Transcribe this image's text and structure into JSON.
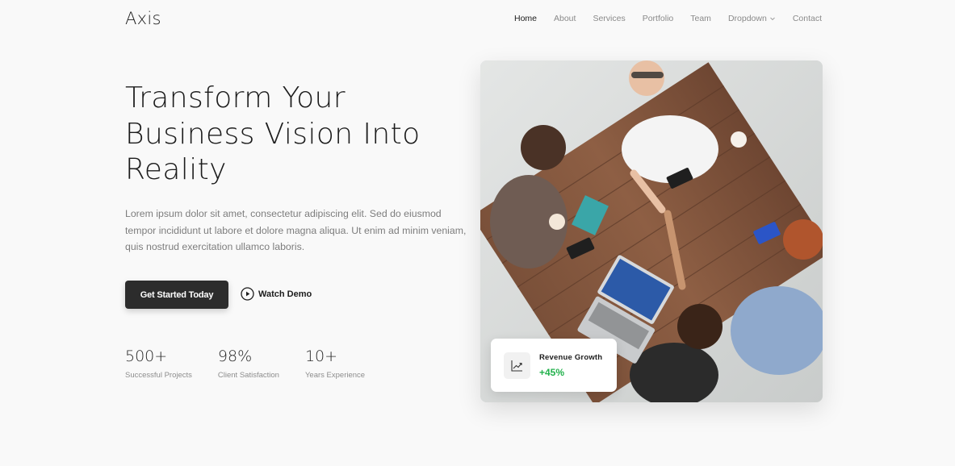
{
  "header": {
    "brand": "Axis",
    "nav": [
      {
        "label": "Home",
        "active": true
      },
      {
        "label": "About"
      },
      {
        "label": "Services"
      },
      {
        "label": "Portfolio"
      },
      {
        "label": "Team"
      },
      {
        "label": "Dropdown",
        "has_chevron": true
      },
      {
        "label": "Contact"
      }
    ]
  },
  "hero": {
    "title_line1": "Transform Your",
    "title_line2": "Business Vision Into",
    "title_line3": "Reality",
    "description": "Lorem ipsum dolor sit amet, consectetur adipiscing elit. Sed do eiusmod tempor incididunt ut labore et dolore magna aliqua. Ut enim ad minim veniam, quis nostrud exercitation ullamco laboris.",
    "primary_button": "Get Started Today",
    "secondary_button": "Watch Demo",
    "secondary_icon": "play-circle-icon"
  },
  "stats": [
    {
      "value": "500+",
      "label": "Successful Projects"
    },
    {
      "value": "98%",
      "label": "Client Satisfaction"
    },
    {
      "value": "10+",
      "label": "Years Experience"
    }
  ],
  "growth_card": {
    "icon": "trending-up-icon",
    "label": "Revenue Growth",
    "value": "+45%"
  },
  "colors": {
    "primary_dark": "#2c2c2c",
    "growth_green": "#22b14c",
    "page_background": "#f9f9f9"
  }
}
